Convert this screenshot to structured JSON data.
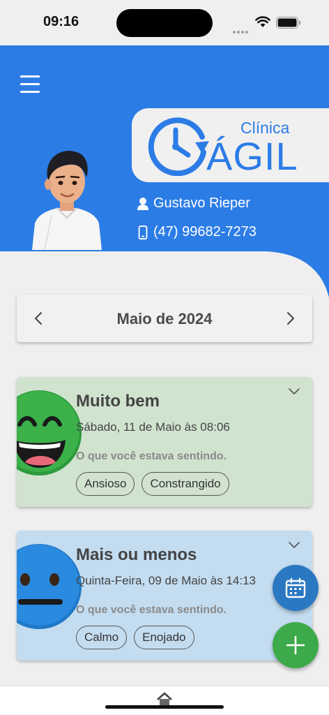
{
  "status_bar": {
    "time": "09:16"
  },
  "header": {
    "menu_icon": "hamburger-menu-icon",
    "logo": {
      "line1": "Clínica",
      "line2": "ÁGIL"
    },
    "user_name": "Gustavo Rieper",
    "user_phone": "(47) 99682-7273",
    "colors": {
      "primary": "#2c7ce6",
      "background": "#efefef"
    }
  },
  "calendar": {
    "month_label": "Maio de 2024",
    "prev_icon": "chevron-left-icon",
    "next_icon": "chevron-right-icon"
  },
  "entries": [
    {
      "mood": "Muito bem",
      "date": "Sábado, 11 de Maio às 08:06",
      "question": "O que você estava sentindo.",
      "tags": [
        "Ansioso",
        "Constrangido"
      ],
      "color": "#d0e3cf",
      "face": "laughing-face-icon"
    },
    {
      "mood": "Mais ou menos",
      "date": "Quinta-Feira, 09 de Maio às 14:13",
      "question": "O que você estava sentindo.",
      "tags": [
        "Calmo",
        "Enojado"
      ],
      "color": "#c3dcf0",
      "face": "neutral-face-icon"
    }
  ],
  "fabs": {
    "calendar_icon": "calendar-icon",
    "add_icon": "plus-icon",
    "calendar_color": "#2b78c2",
    "add_color": "#3caa4a"
  },
  "bottom_nav": {
    "home_icon": "home-icon"
  }
}
